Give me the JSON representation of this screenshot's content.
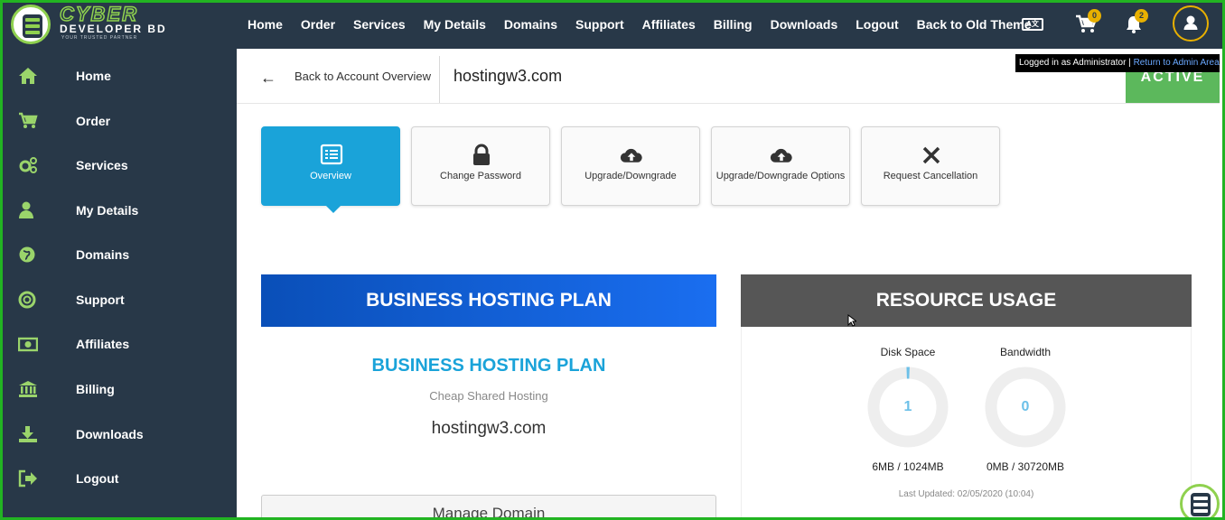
{
  "brand": {
    "title": "CYBER",
    "subtitle": "DEVELOPER BD",
    "tagline": "YOUR TRUSTED PARTNER"
  },
  "topnav": [
    "Home",
    "Order",
    "Services",
    "My Details",
    "Domains",
    "Support",
    "Affiliates",
    "Billing",
    "Downloads",
    "Logout",
    "Back to Old Theme"
  ],
  "top_icons": {
    "translate_icon": "translate-icon",
    "cart_icon": "cart-icon",
    "cart_count": "0",
    "bell_icon": "bell-icon",
    "notification_count": "2",
    "user_icon": "user-icon",
    "badge_color": "#e8b000"
  },
  "admin_bar": {
    "text": "Logged in as Administrator",
    "separator": "|",
    "link": "Return to Admin Area"
  },
  "sidebar": [
    {
      "label": "Home",
      "icon": "home-icon"
    },
    {
      "label": "Order",
      "icon": "cart-icon"
    },
    {
      "label": "Services",
      "icon": "gears-icon"
    },
    {
      "label": "My Details",
      "icon": "user-icon"
    },
    {
      "label": "Domains",
      "icon": "globe-icon"
    },
    {
      "label": "Support",
      "icon": "lifebuoy-icon"
    },
    {
      "label": "Affiliates",
      "icon": "money-icon"
    },
    {
      "label": "Billing",
      "icon": "bank-icon"
    },
    {
      "label": "Downloads",
      "icon": "download-icon"
    },
    {
      "label": "Logout",
      "icon": "sign-out-icon"
    }
  ],
  "content": {
    "back_label": "Back to Account Overview",
    "domain": "hostingw3.com",
    "status": "ACTIVE",
    "status_color": "#5cb85c"
  },
  "tabs": [
    {
      "label": "Overview",
      "icon": "list-icon",
      "active": true
    },
    {
      "label": "Change Password",
      "icon": "lock-icon"
    },
    {
      "label": "Upgrade/Downgrade",
      "icon": "cloud-upload-icon"
    },
    {
      "label": "Upgrade/Downgrade Options",
      "icon": "cloud-upload-icon"
    },
    {
      "label": "Request Cancellation",
      "icon": "close-icon"
    }
  ],
  "plan": {
    "header": "BUSINESS HOSTING PLAN",
    "name": "BUSINESS HOSTING PLAN",
    "group": "Cheap Shared Hosting",
    "domain": "hostingw3.com",
    "manage_button": "Manage Domain"
  },
  "resources": {
    "header": "RESOURCE USAGE",
    "disk": {
      "label": "Disk Space",
      "percent": "1",
      "usage": "6MB / 1024MB"
    },
    "bandwidth": {
      "label": "Bandwidth",
      "percent": "0",
      "usage": "0MB / 30720MB"
    },
    "last_updated": "Last Updated: 02/05/2020 (10:04)"
  },
  "colors": {
    "nav_bg": "#283848",
    "accent_blue": "#1aa3d9",
    "frame_green": "#22b422"
  }
}
